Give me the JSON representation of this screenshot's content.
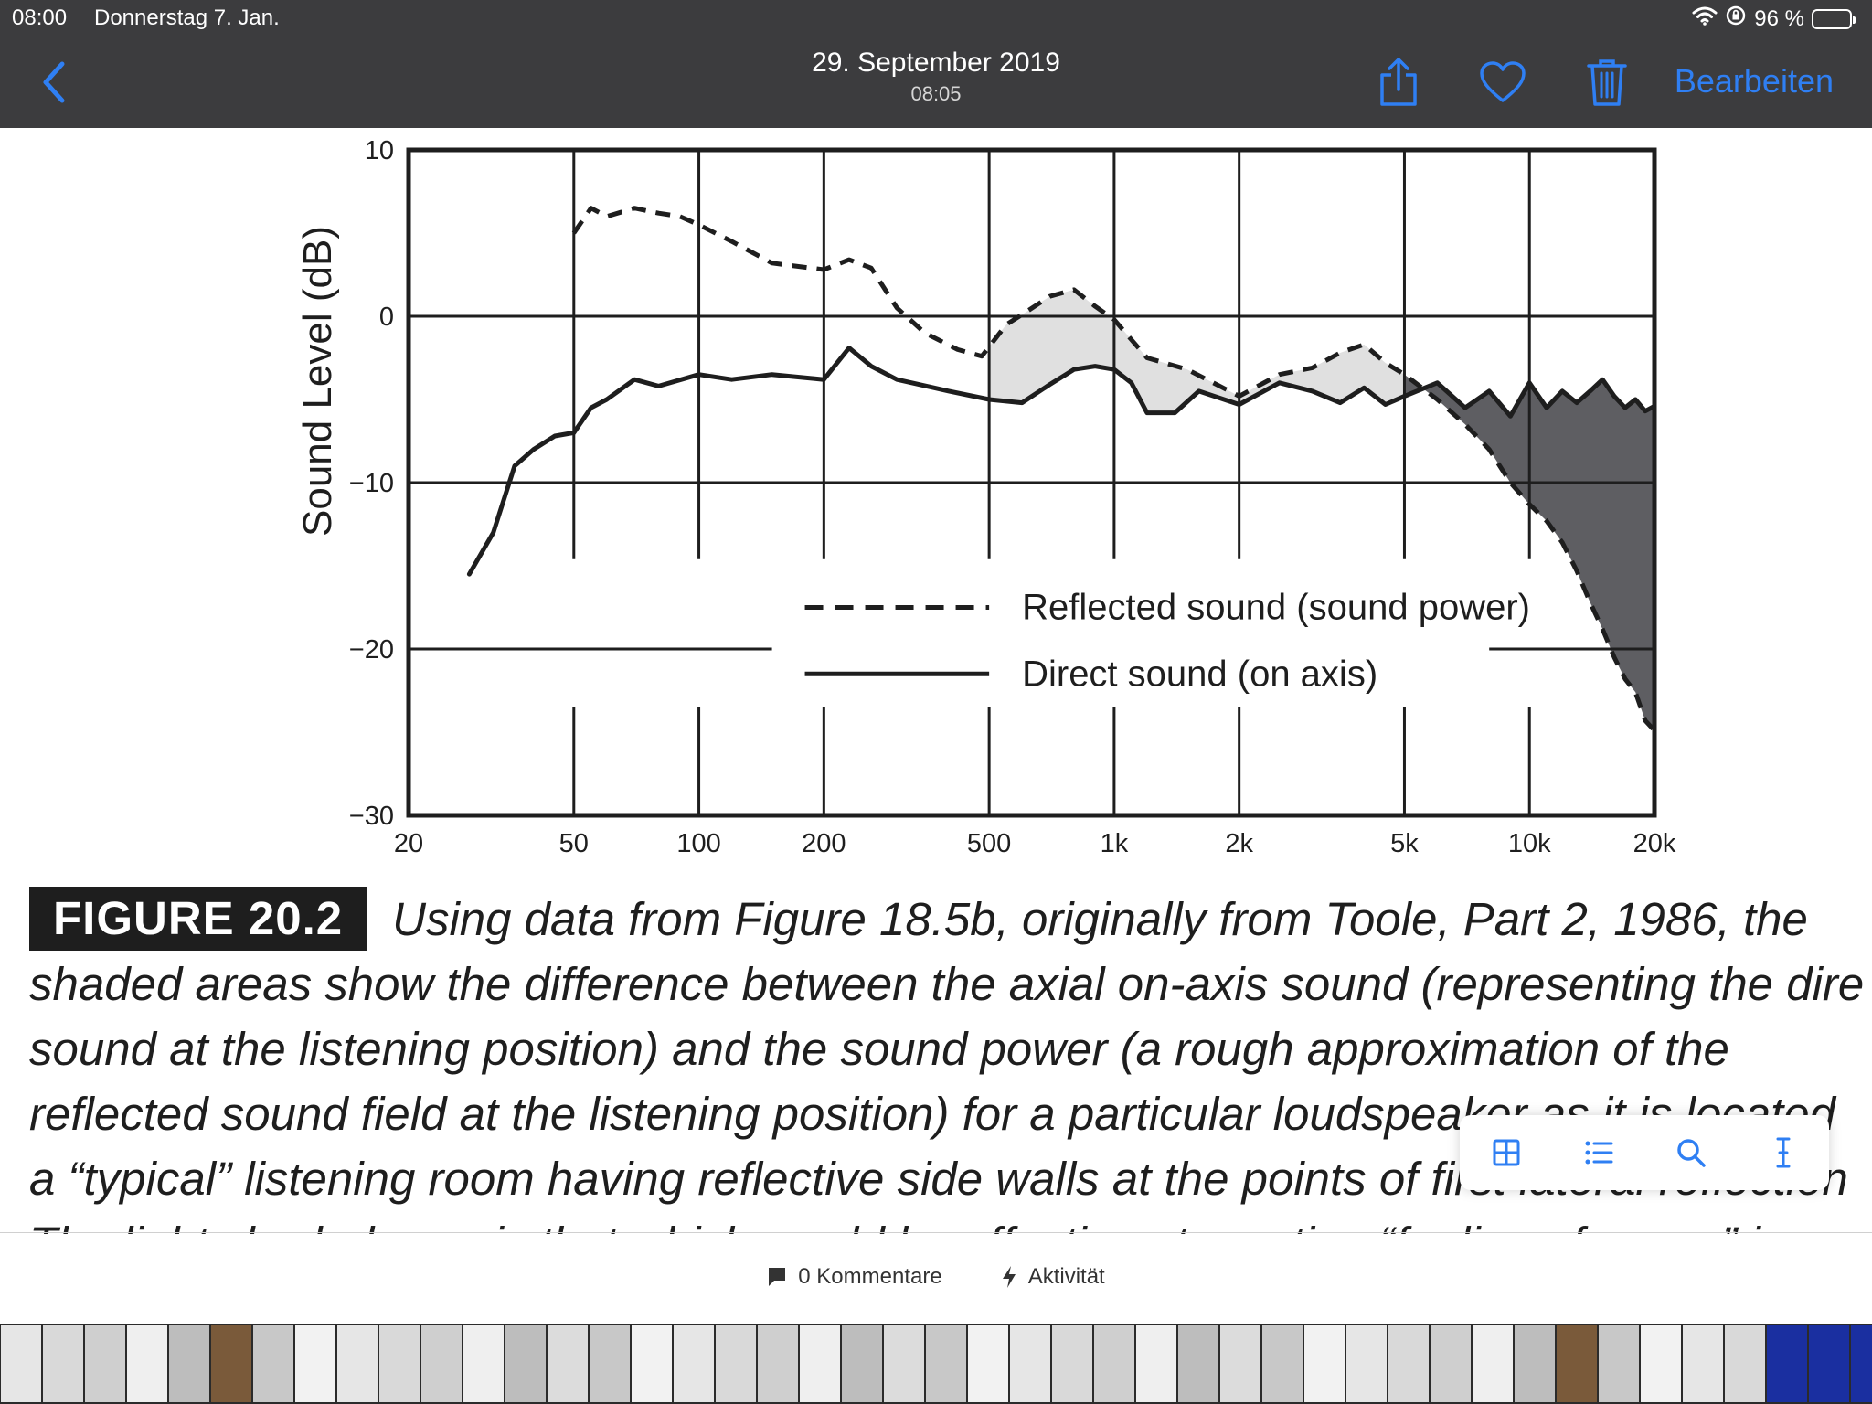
{
  "status_bar": {
    "time": "08:00",
    "date": "Donnerstag 7. Jan.",
    "battery_percent": "96 %",
    "battery_level": 0.96
  },
  "nav": {
    "title_date": "29. September 2019",
    "title_time": "08:05",
    "edit_label": "Bearbeiten",
    "accent_color": "#2f7ff3"
  },
  "chart_data": {
    "type": "line",
    "title": "",
    "xlabel": "",
    "ylabel": "Sound Level (dB)",
    "x_scale": "log",
    "xlim": [
      20,
      20000
    ],
    "ylim": [
      -30,
      10
    ],
    "x_ticks": [
      20,
      50,
      100,
      200,
      500,
      1000,
      2000,
      5000,
      10000,
      20000
    ],
    "x_tick_labels": [
      "20",
      "50",
      "100",
      "200",
      "500",
      "1k",
      "2k",
      "5k",
      "10k",
      "20k"
    ],
    "y_ticks": [
      10,
      0,
      -10,
      -20,
      -30
    ],
    "y_tick_labels": [
      "10",
      "0",
      "−10",
      "−20",
      "−30"
    ],
    "grid": true,
    "legend_position": "lower-center",
    "series": [
      {
        "name": "Reflected sound (sound power)",
        "style": "dashed",
        "x": [
          50,
          55,
          60,
          70,
          80,
          90,
          100,
          120,
          150,
          200,
          230,
          260,
          300,
          350,
          420,
          480,
          550,
          600,
          700,
          800,
          900,
          1000,
          1200,
          1500,
          2000,
          2500,
          3000,
          3500,
          4000,
          4500,
          5000,
          6000,
          7000,
          8000,
          9000,
          10000,
          11000,
          12000,
          13000,
          14000,
          15000,
          16000,
          17000,
          18000,
          19000,
          20000
        ],
        "y": [
          5,
          6.5,
          6,
          6.5,
          6.2,
          6,
          5.5,
          4.5,
          3.2,
          2.8,
          3.4,
          2.9,
          0.5,
          -1,
          -2,
          -2.4,
          -0.5,
          0.1,
          1.2,
          1.6,
          0.6,
          -0.2,
          -2.5,
          -3.2,
          -4.8,
          -3.5,
          -3.1,
          -2.2,
          -1.7,
          -2.8,
          -3.5,
          -5.0,
          -6.5,
          -8.0,
          -10.0,
          -11.3,
          -12.3,
          -13.6,
          -15.3,
          -17.2,
          -18.8,
          -20.5,
          -21.8,
          -22.6,
          -24.3,
          -24.9
        ]
      },
      {
        "name": "Direct sound (on axis)",
        "style": "solid",
        "x": [
          28,
          32,
          36,
          40,
          45,
          50,
          55,
          60,
          70,
          80,
          100,
          120,
          150,
          200,
          230,
          260,
          300,
          400,
          500,
          600,
          700,
          800,
          900,
          1000,
          1100,
          1200,
          1400,
          1600,
          2000,
          2500,
          3000,
          3500,
          4000,
          4500,
          5000,
          6000,
          7000,
          8000,
          9000,
          10000,
          11000,
          12000,
          13000,
          14000,
          15000,
          16000,
          17000,
          18000,
          19000,
          20000
        ],
        "y": [
          -15.5,
          -13,
          -9,
          -8,
          -7.2,
          -7,
          -5.5,
          -5,
          -3.8,
          -4.2,
          -3.5,
          -3.8,
          -3.5,
          -3.8,
          -1.9,
          -3.0,
          -3.8,
          -4.5,
          -5.0,
          -5.2,
          -4.1,
          -3.2,
          -3.0,
          -3.2,
          -4.0,
          -5.8,
          -5.8,
          -4.5,
          -5.3,
          -4.0,
          -4.5,
          -5.2,
          -4.3,
          -5.3,
          -4.8,
          -4.0,
          -5.5,
          -4.5,
          -6.0,
          -4.0,
          -5.5,
          -4.5,
          -5.2,
          -4.5,
          -3.8,
          -4.8,
          -5.5,
          -5.0,
          -5.7,
          -5.4
        ]
      }
    ],
    "shaded_regions": [
      {
        "from": 500,
        "to": 5000,
        "fill": "#e0e0e0",
        "meaning": "reflected above direct"
      },
      {
        "from": 5000,
        "to": 20000,
        "fill": "#5e5e62",
        "meaning": "direct above reflected"
      }
    ]
  },
  "caption": {
    "figure_label": "FIGURE 20.2",
    "lines": [
      "Using data from Figure 18.5b, originally from Toole, Part 2, 1986, the",
      "shaded areas show the difference between the axial on-axis sound (representing the dire",
      "sound at the listening position) and the sound power (a rough approximation of the",
      "reflected sound field at the listening position) for a particular loudspeaker as it is located",
      "a “typical” listening room having reflective side walls at the points of first lateral reflection",
      "The light shaded area is that which would be effective at creating “feeling of space” i"
    ]
  },
  "text_toolbar": {
    "icons": [
      "grid-icon",
      "list-icon",
      "search-icon",
      "text-cursor-icon"
    ]
  },
  "footer": {
    "comments_label": "0 Kommentare",
    "activity_label": "Aktivität"
  }
}
